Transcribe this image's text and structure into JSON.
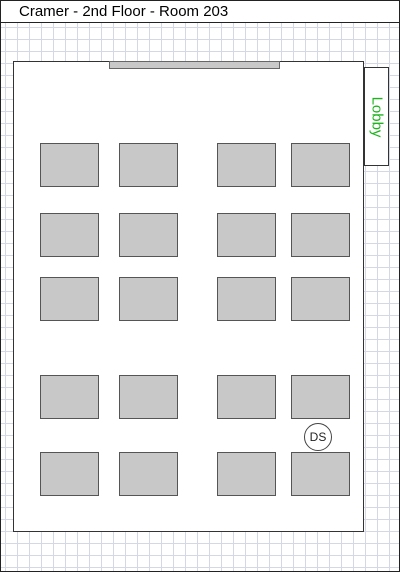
{
  "header": {
    "title": "Cramer - 2nd Floor - Room 203"
  },
  "room": {
    "lobby_label": "Lobby",
    "marker_label": "DS"
  },
  "colors": {
    "desk_fill": "#c8c8c8",
    "grid_line": "#d4d8e6",
    "lobby_text": "#1db31d"
  }
}
